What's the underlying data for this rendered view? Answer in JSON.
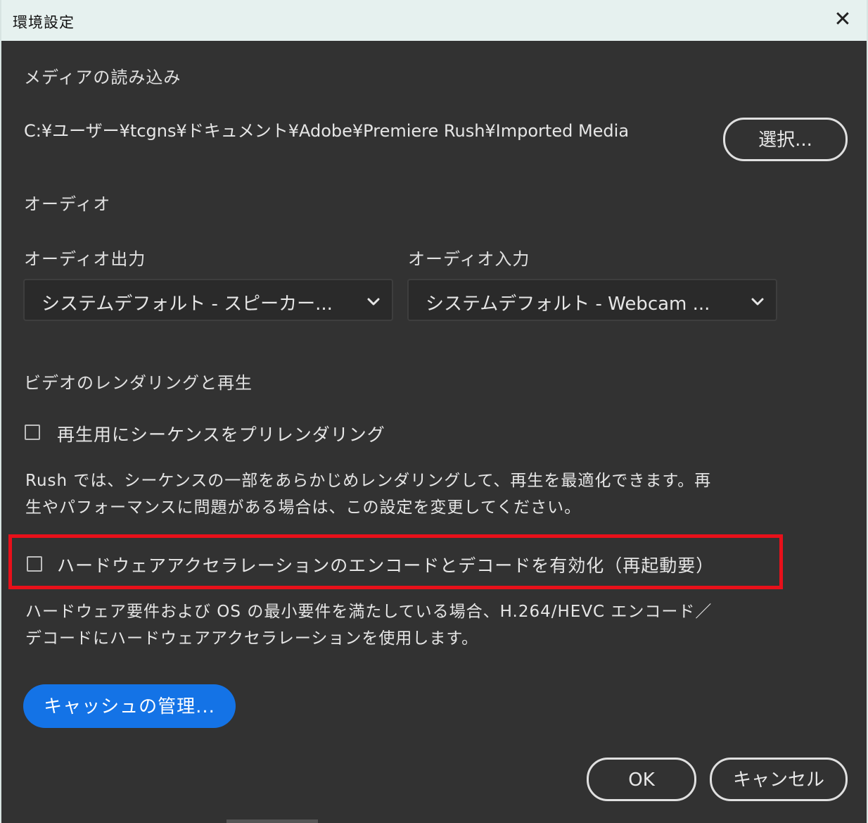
{
  "window": {
    "title": "環境設定",
    "close_glyph": "✕"
  },
  "media": {
    "heading": "メディアの読み込み",
    "path": "C:¥ユーザー¥tcgns¥ドキュメント¥Adobe¥Premiere Rush¥Imported Media",
    "select_button": "選択..."
  },
  "audio": {
    "heading": "オーディオ",
    "output_label": "オーディオ出力",
    "output_value": "システムデフォルト - スピーカー...",
    "input_label": "オーディオ入力",
    "input_value": "システムデフォルト - Webcam ..."
  },
  "video": {
    "heading": "ビデオのレンダリングと再生",
    "prerender_label": "再生用にシーケンスをプリレンダリング",
    "prerender_checked": false,
    "prerender_desc_line1": "Rush では、シーケンスの一部をあらかじめレンダリングして、再生を最適化できます。再",
    "prerender_desc_line2": "生やパフォーマンスに問題がある場合は、この設定を変更してください。",
    "hwaccel_label": "ハードウェアアクセラレーションのエンコードとデコードを有効化（再起動要）",
    "hwaccel_checked": false,
    "hwaccel_desc_line1": "ハードウェア要件および OS の最小要件を満たしている場合、H.264/HEVC エンコード／",
    "hwaccel_desc_line2": "デコードにハードウェアアクセラレーションを使用します。"
  },
  "cache_button": "キャッシュの管理...",
  "footer": {
    "ok_label": "OK",
    "cancel_label": "キャンセル"
  },
  "colors": {
    "accent": "#1473e6",
    "highlight": "#e8101a",
    "background": "#323232"
  }
}
